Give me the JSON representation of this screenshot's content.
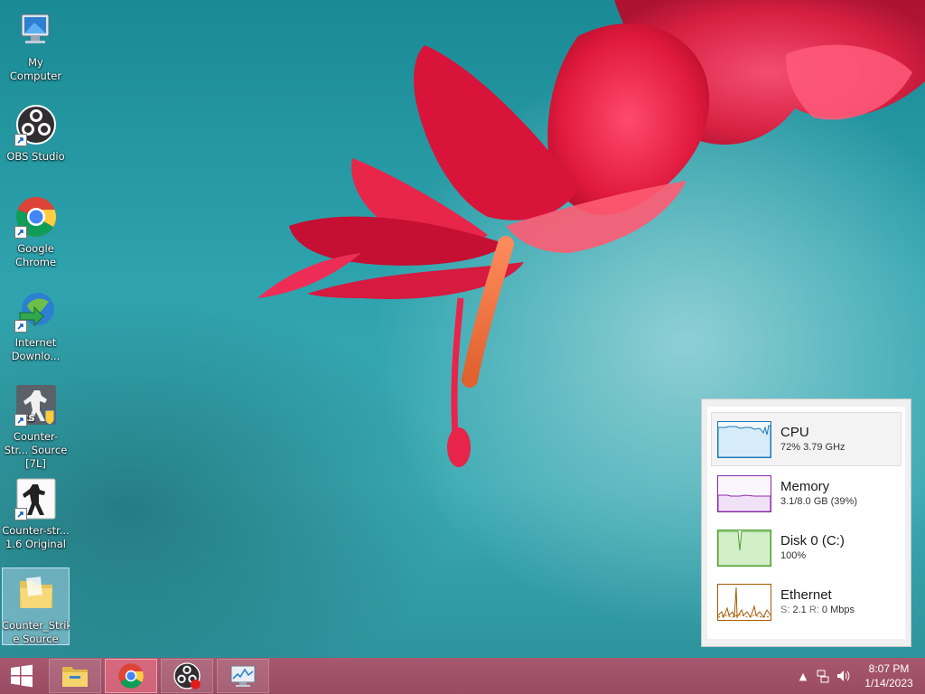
{
  "desktop": {
    "icons": [
      {
        "label": "My Computer",
        "icon": "computer-icon"
      },
      {
        "label": "OBS Studio",
        "icon": "obs-icon"
      },
      {
        "label": "Google Chrome",
        "icon": "chrome-icon"
      },
      {
        "label": "Internet Downlo...",
        "icon": "internet-download-manager-icon"
      },
      {
        "label": "Counter-Str... Source [7L]",
        "icon": "counter-strike-source-icon"
      },
      {
        "label": "Counter-str... 1.6 Original",
        "icon": "counter-strike-16-icon"
      },
      {
        "label": "Counter_Strik e Source",
        "icon": "folder-icon",
        "selected": true
      }
    ]
  },
  "performance": {
    "items": [
      {
        "name": "CPU",
        "detail": "72% 3.79 GHz",
        "color": "#1a7ab8",
        "selected": true
      },
      {
        "name": "Memory",
        "detail": "3.1/8.0 GB (39%)",
        "color": "#8b2aa7",
        "selected": false
      },
      {
        "name": "Disk 0 (C:)",
        "detail": "100%",
        "color": "#4aa02c",
        "selected": false
      },
      {
        "name": "Ethernet",
        "detail_s_label": "S:",
        "detail_s_value": "2.1",
        "detail_r_label": "R:",
        "detail_r_value": "0 Mbps",
        "color": "#a75a00",
        "selected": false
      }
    ]
  },
  "taskbar": {
    "start": "start-windows-icon",
    "apps": [
      {
        "name": "file-explorer-icon",
        "active": false
      },
      {
        "name": "chrome-icon",
        "active": true
      },
      {
        "name": "obs-icon",
        "active": false
      },
      {
        "name": "performance-monitor-icon",
        "active": false
      }
    ],
    "tray": {
      "time": "8:07 PM",
      "date": "1/14/2023"
    }
  },
  "colors": {
    "taskbar": "#a1526a",
    "desktop_bg": "#2ea3ad",
    "flower": "#e0203f"
  }
}
